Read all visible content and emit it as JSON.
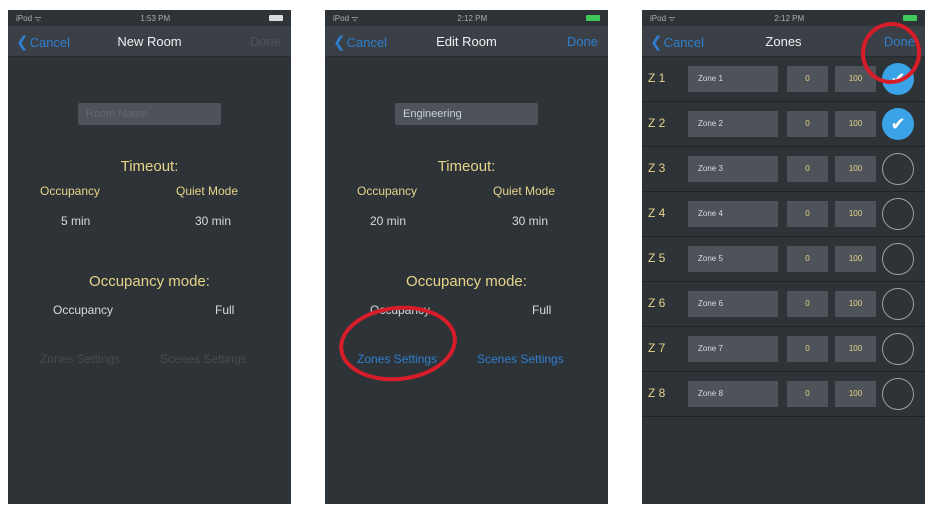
{
  "screen_new": {
    "status": {
      "carrier": "iPod ᯤ",
      "time": "1:53 PM"
    },
    "nav": {
      "cancel": "Cancel",
      "title": "New Room",
      "done": "Done"
    },
    "name_placeholder": "Room Name",
    "timeout_title": "Timeout:",
    "occupancy_label": "Occupancy",
    "quiet_label": "Quiet Mode",
    "occupancy_value": "5 min",
    "quiet_value": "30 min",
    "mode_title": "Occupancy mode:",
    "mode_label": "Occupancy",
    "mode_value": "Full",
    "zones_link": "Zones Settings",
    "scenes_link": "Scenes Settings"
  },
  "screen_edit": {
    "status": {
      "carrier": "iPod ᯤ",
      "time": "2:12 PM"
    },
    "nav": {
      "cancel": "Cancel",
      "title": "Edit Room",
      "done": "Done"
    },
    "name_value": "Engineering",
    "timeout_title": "Timeout:",
    "occupancy_label": "Occupancy",
    "quiet_label": "Quiet Mode",
    "occupancy_value": "20 min",
    "quiet_value": "30 min",
    "mode_title": "Occupancy mode:",
    "mode_label": "Occupancy",
    "mode_value": "Full",
    "zones_link": "Zones Settings",
    "scenes_link": "Scenes Settings"
  },
  "screen_zones": {
    "status": {
      "carrier": "iPod ᯤ",
      "time": "2:12 PM"
    },
    "nav": {
      "cancel": "Cancel",
      "title": "Zones",
      "done": "Done"
    },
    "check_glyph": "✔",
    "zones": [
      {
        "label": "Z 1",
        "name": "Zone 1",
        "min": "0",
        "max": "100",
        "checked": true
      },
      {
        "label": "Z 2",
        "name": "Zone 2",
        "min": "0",
        "max": "100",
        "checked": true
      },
      {
        "label": "Z 3",
        "name": "Zone 3",
        "min": "0",
        "max": "100",
        "checked": false
      },
      {
        "label": "Z 4",
        "name": "Zone 4",
        "min": "0",
        "max": "100",
        "checked": false
      },
      {
        "label": "Z 5",
        "name": "Zone 5",
        "min": "0",
        "max": "100",
        "checked": false
      },
      {
        "label": "Z 6",
        "name": "Zone 6",
        "min": "0",
        "max": "100",
        "checked": false
      },
      {
        "label": "Z 7",
        "name": "Zone 7",
        "min": "0",
        "max": "100",
        "checked": false
      },
      {
        "label": "Z 8",
        "name": "Zone 8",
        "min": "0",
        "max": "100",
        "checked": false
      }
    ]
  },
  "colors": {
    "background": "#2e3337",
    "accent": "#2f7ecf",
    "label": "#e6d48a",
    "highlight_circle": "#d81d2a",
    "check": "#3aa3e8"
  },
  "icons": [
    "chevron-left-icon",
    "wifi-icon",
    "battery-icon",
    "checkmark-icon"
  ]
}
